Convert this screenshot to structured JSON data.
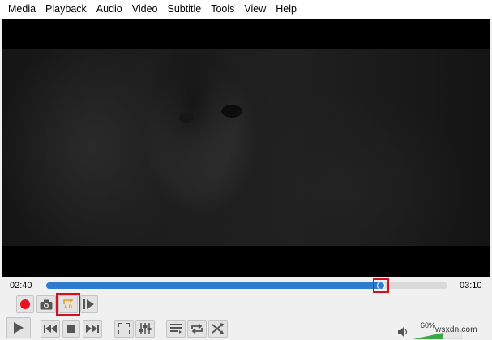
{
  "menu": [
    "Media",
    "Playback",
    "Audio",
    "Video",
    "Subtitle",
    "Tools",
    "View",
    "Help"
  ],
  "playback": {
    "elapsed": "02:40",
    "total": "03:10",
    "position_fraction": 0.835
  },
  "toolbar_top": {
    "record": "record-icon",
    "snapshot": "camera-icon",
    "ab_loop": "ab-loop-icon",
    "frame_step": "frame-step-icon",
    "ab_label": "A B"
  },
  "toolbar_bottom": {
    "play": "play-icon",
    "previous": "previous-icon",
    "stop": "stop-icon",
    "next": "next-icon",
    "fullscreen": "fullscreen-icon",
    "extended_settings": "equalizer-icon",
    "playlist": "playlist-icon",
    "loop": "loop-icon",
    "random": "shuffle-icon"
  },
  "volume": {
    "percent_label": "60%",
    "level_fraction": 0.6
  },
  "watermark": "wsxdn.com",
  "colors": {
    "accent": "#2e7bd0",
    "highlight": "#d5101f",
    "record": "#e81123",
    "ab_icon": "#e8a21a",
    "volume": "#3aa845"
  }
}
